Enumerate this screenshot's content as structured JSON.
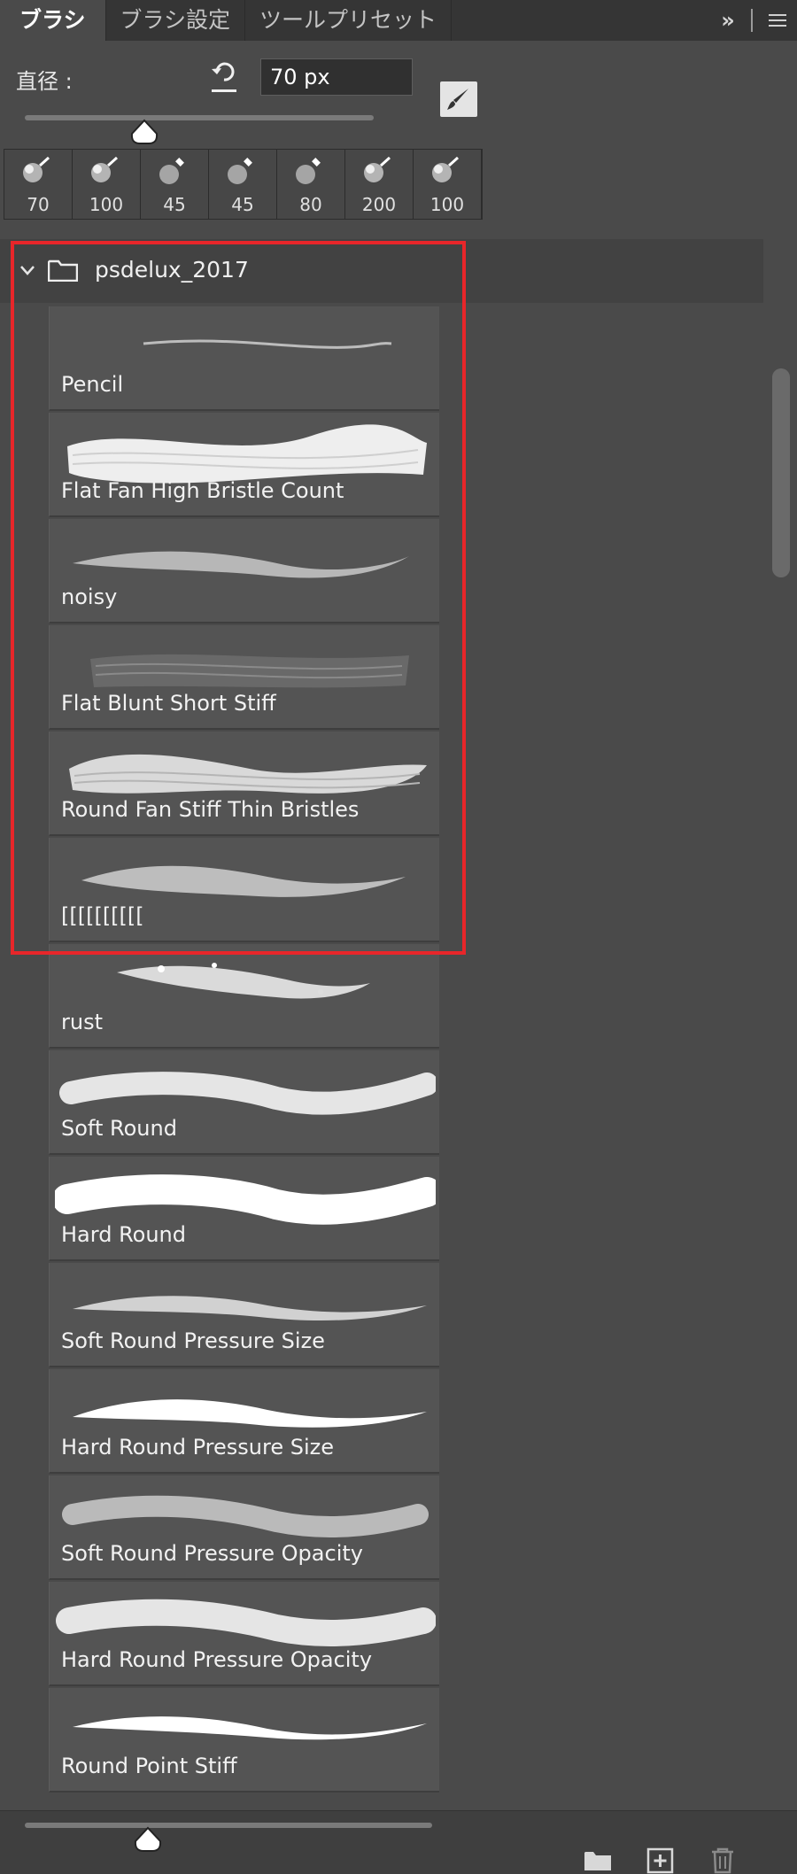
{
  "tabs": [
    {
      "label": "ブラシ",
      "active": true
    },
    {
      "label": "ブラシ設定",
      "active": false
    },
    {
      "label": "ツールプリセット",
      "active": false
    }
  ],
  "tab_controls": {
    "expand_label": "»"
  },
  "diameter": {
    "label": "直径 :",
    "value": "70 px",
    "slider_percent": 30
  },
  "recent_brushes": [
    {
      "size": "70"
    },
    {
      "size": "100"
    },
    {
      "size": "45"
    },
    {
      "size": "45"
    },
    {
      "size": "80"
    },
    {
      "size": "200"
    },
    {
      "size": "100"
    }
  ],
  "group": {
    "name": "psdelux_2017",
    "expanded": true
  },
  "brushes": [
    {
      "name": "Pencil",
      "stroke": "thin-line"
    },
    {
      "name": "Flat Fan High Bristle Count",
      "stroke": "wide-bristle"
    },
    {
      "name": "noisy",
      "stroke": "noisy"
    },
    {
      "name": "Flat Blunt Short Stiff",
      "stroke": "faint-bristle"
    },
    {
      "name": "Round Fan Stiff Thin Bristles",
      "stroke": "fan-bristle"
    },
    {
      "name": "[[[[[[[[[[",
      "stroke": "soft-taper"
    },
    {
      "name": "rust",
      "stroke": "rust"
    },
    {
      "name": "Soft Round",
      "stroke": "soft-round"
    },
    {
      "name": "Hard Round",
      "stroke": "hard-round"
    },
    {
      "name": "Soft Round Pressure Size",
      "stroke": "soft-pressure-size"
    },
    {
      "name": "Hard Round Pressure Size",
      "stroke": "hard-pressure-size"
    },
    {
      "name": "Soft Round Pressure Opacity",
      "stroke": "soft-pressure-opacity"
    },
    {
      "name": "Hard Round Pressure Opacity",
      "stroke": "hard-pressure-opacity"
    },
    {
      "name": "Round Point Stiff",
      "stroke": "point-stiff"
    }
  ],
  "colors": {
    "panel_bg": "#4a4a4a",
    "tab_bar_bg": "#353535",
    "highlight": "#e8262a",
    "item_bg": "#545454"
  },
  "bottom_bar": {
    "preview_slider_percent": 22,
    "icons": [
      "folder-icon",
      "new-brush-icon",
      "trash-icon"
    ]
  }
}
